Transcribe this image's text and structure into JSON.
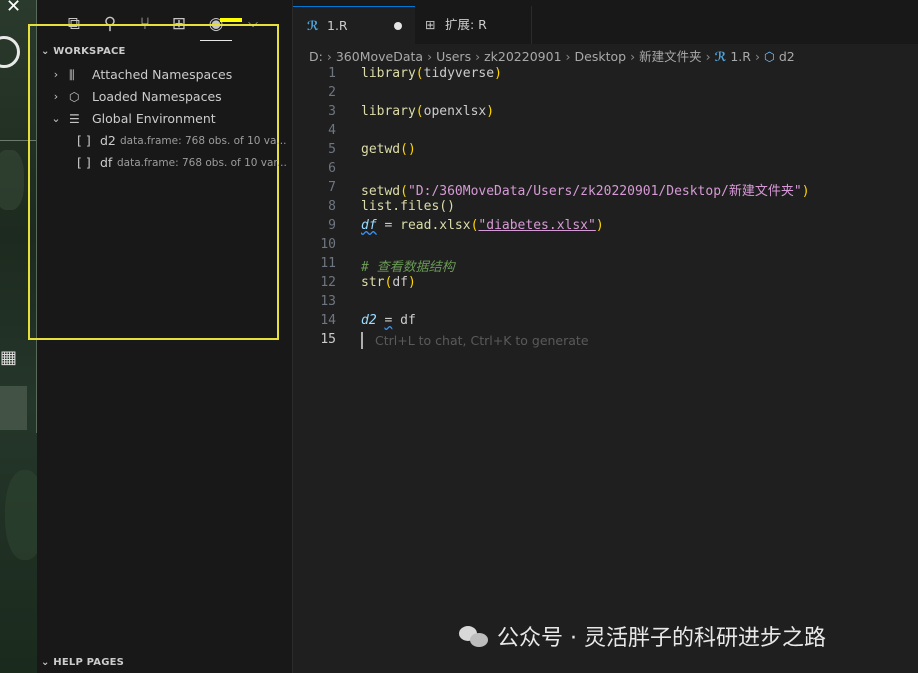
{
  "sidebar": {
    "workspace_header": "WORKSPACE",
    "help_header": "HELP PAGES",
    "tree": [
      {
        "label": "Attached Namespaces",
        "icon": "library-icon"
      },
      {
        "label": "Loaded Namespaces",
        "icon": "package-icon"
      },
      {
        "label": "Global Environment",
        "icon": "list-icon"
      }
    ],
    "variables": [
      {
        "bracket": "[ ]",
        "name": "d2",
        "desc": "data.frame: 768 obs. of 10 va..."
      },
      {
        "bracket": "[ ]",
        "name": "df",
        "desc": "data.frame: 768 obs. of 10 var..."
      }
    ]
  },
  "editor": {
    "tabs": [
      {
        "label": "1.R",
        "modified": true
      },
      {
        "label": "扩展: R"
      }
    ],
    "breadcrumb": [
      "D:",
      "360MoveData",
      "Users",
      "zk20220901",
      "Desktop",
      "新建文件夹",
      "1.R",
      "d2"
    ],
    "lines": {
      "l1": {
        "fn": "library",
        "arg": "tidyverse"
      },
      "l3": {
        "fn": "library",
        "arg": "openxlsx"
      },
      "l5": {
        "fn": "getwd"
      },
      "l7": {
        "fn": "setwd",
        "path": "\"D:/360MoveData/Users/zk20220901/Desktop/新建文件夹\""
      },
      "l8": {
        "code": "list.files()"
      },
      "l9": {
        "var": "df",
        "op": "=",
        "fn": "read.xlsx",
        "str": "\"diabetes.xlsx\""
      },
      "l11": {
        "comment": "# 查看数据结构"
      },
      "l12": {
        "fn": "str",
        "arg": "df"
      },
      "l14": {
        "var": "d2",
        "op": "=",
        "val": "df"
      }
    },
    "line_numbers": [
      "1",
      "2",
      "3",
      "4",
      "5",
      "6",
      "7",
      "8",
      "9",
      "10",
      "11",
      "12",
      "13",
      "14",
      "15"
    ],
    "ghost_hint": "Ctrl+L to chat, Ctrl+K to generate"
  },
  "watermark": "公众号 · 灵活胖子的科研进步之路"
}
